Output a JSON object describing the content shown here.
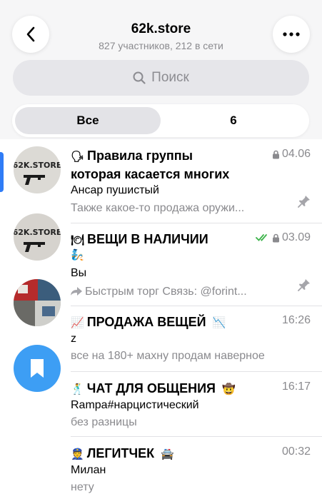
{
  "header": {
    "title": "62k.store",
    "subtitle": "827 участников, 212 в сети",
    "search_placeholder": "Поиск"
  },
  "tabs": [
    {
      "label": "Все",
      "selected": true
    },
    {
      "label": "6",
      "selected": false
    }
  ],
  "sidebar": {
    "avatar_text": "62K.STORE"
  },
  "chats": [
    {
      "emoji": "🗣",
      "title_line1": "Правила группы",
      "title_line2": "которая касается многих",
      "time": "04.06",
      "sender": "Ансар пушистый",
      "preview": "Также какое-то продажа оружи..."
    },
    {
      "emoji": "🍽",
      "title": "ВЕЩИ В НАЛИЧИИ",
      "time": "03.09",
      "line2": "🧞",
      "sender": "Вы",
      "preview": "Быстрым торг Связь: @forint..."
    },
    {
      "emoji": "📈",
      "title": "ПРОДАЖА ВЕЩЕЙ",
      "title_suffix": "📉",
      "time": "16:26",
      "sender": "z",
      "preview": "все на 180+ махну продам наверное"
    },
    {
      "emoji": "🕺",
      "title": "ЧАТ ДЛЯ ОБЩЕНИЯ",
      "title_suffix": "🤠",
      "time": "16:17",
      "sender": "Rampa#нарцистический",
      "preview": "без разницы"
    },
    {
      "emoji": "👮",
      "title": "ЛЕГИТЧЕК",
      "title_suffix": "🚔",
      "time": "00:32",
      "sender": "Милан",
      "preview": "нету"
    }
  ],
  "colors": {
    "accent": "#2f7cf6",
    "read_check": "#3cb34a",
    "secondary_text": "#8a8a8e"
  }
}
